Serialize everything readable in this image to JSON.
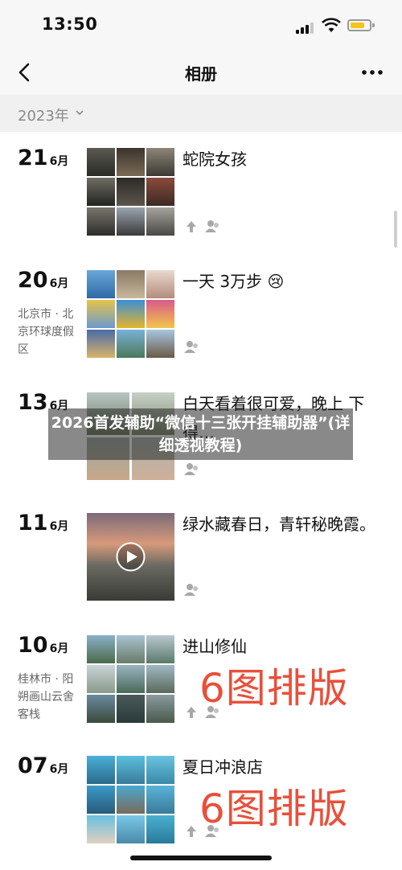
{
  "status_bar": {
    "time": "13:50"
  },
  "nav": {
    "title": "相册"
  },
  "year_filter": {
    "label": "2023年"
  },
  "entries": [
    {
      "day": "21",
      "month": "6月",
      "location": "",
      "caption": "蛇院女孩"
    },
    {
      "day": "20",
      "month": "6月",
      "location": "北京市 · 北京环球度假区",
      "caption": "一天 3万步 😢"
    },
    {
      "day": "13",
      "month": "6月",
      "location": "",
      "caption": "白天看着很可爱，晚上  下得…"
    },
    {
      "day": "11",
      "month": "6月",
      "location": "",
      "caption": "绿水藏春日，青轩秘晚霞。"
    },
    {
      "day": "10",
      "month": "6月",
      "location": "桂林市 · 阳朔画山云舍客栈",
      "caption": "进山修仙"
    },
    {
      "day": "07",
      "month": "6月",
      "location": "",
      "caption": "夏日冲浪店"
    }
  ],
  "overlays": {
    "layout_label": "6图排版"
  },
  "banner": {
    "text": "2026首发辅助“微信十三张开挂辅助器”(详细透视教程)"
  }
}
